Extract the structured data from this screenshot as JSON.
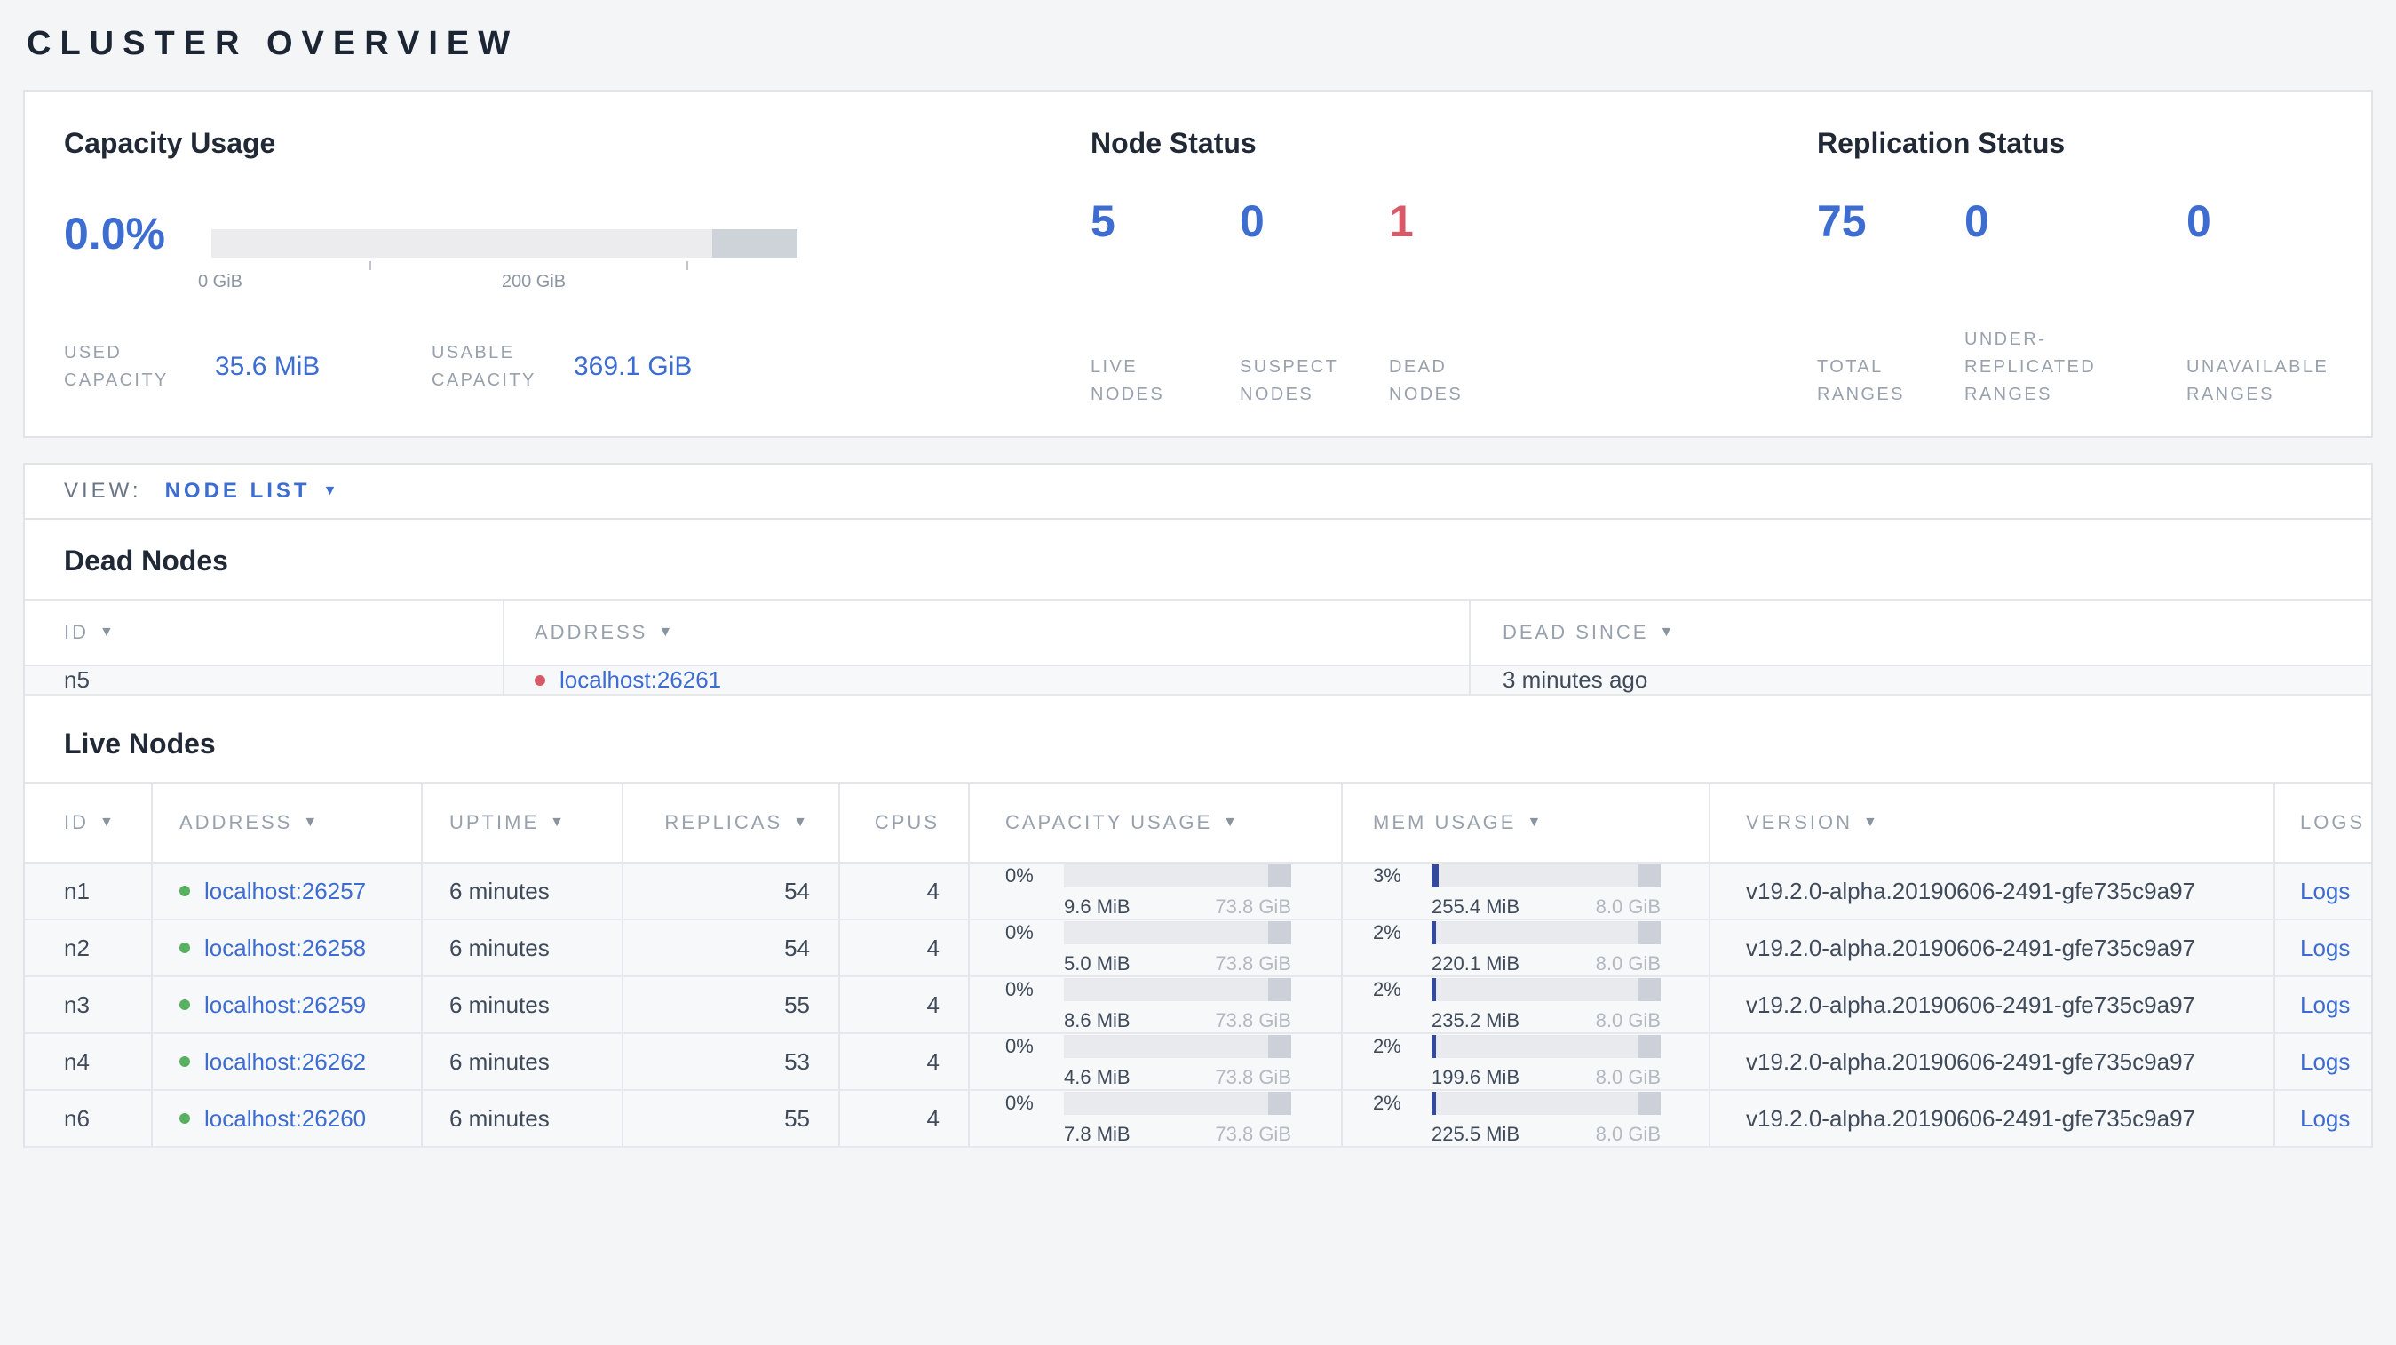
{
  "colors": {
    "accent_blue": "#3d6dd1",
    "status_red": "#d85a68",
    "status_green": "#57b15f"
  },
  "page": {
    "title": "CLUSTER OVERVIEW"
  },
  "summary": {
    "capacity": {
      "heading": "Capacity Usage",
      "percent": "0.0%",
      "fill": "0%",
      "axis_start": "0 GiB",
      "axis_mid": "200 GiB",
      "used": {
        "label_line1": "USED",
        "label_line2": "CAPACITY",
        "value": "35.6 MiB"
      },
      "usable": {
        "label_line1": "USABLE",
        "label_line2": "CAPACITY",
        "value": "369.1 GiB"
      }
    },
    "node_status": {
      "heading": "Node Status",
      "live": {
        "value": "5",
        "label_line1": "LIVE",
        "label_line2": "NODES"
      },
      "suspect": {
        "value": "0",
        "label_line1": "SUSPECT",
        "label_line2": "NODES"
      },
      "dead": {
        "value": "1",
        "label_line1": "DEAD",
        "label_line2": "NODES"
      }
    },
    "replication": {
      "heading": "Replication Status",
      "total": {
        "value": "75",
        "label_line1": "TOTAL",
        "label_line2": "RANGES"
      },
      "under_replicated": {
        "value": "0",
        "label_line1": "UNDER-",
        "label_line2": "REPLICATED",
        "label_line3": "RANGES"
      },
      "unavailable": {
        "value": "0",
        "label_line1": "UNAVAILABLE",
        "label_line2": "RANGES"
      }
    }
  },
  "view_bar": {
    "label": "VIEW:",
    "selected": "NODE LIST"
  },
  "dead_nodes": {
    "heading": "Dead Nodes",
    "columns": {
      "id": "ID",
      "address": "ADDRESS",
      "dead_since": "DEAD SINCE"
    },
    "rows": [
      {
        "id": "n5",
        "address": "localhost:26261",
        "dead_since": "3 minutes ago"
      }
    ]
  },
  "live_nodes": {
    "heading": "Live Nodes",
    "columns": {
      "id": "ID",
      "address": "ADDRESS",
      "uptime": "UPTIME",
      "replicas": "REPLICAS",
      "cpus": "CPUS",
      "capacity": "CAPACITY USAGE",
      "mem": "MEM USAGE",
      "version": "VERSION",
      "logs": "LOGS"
    },
    "rows": [
      {
        "id": "n1",
        "address": "localhost:26257",
        "uptime": "6 minutes",
        "replicas": "54",
        "cpus": "4",
        "capacity": {
          "pct": "0%",
          "fill": "0%",
          "used": "9.6 MiB",
          "total": "73.8 GiB"
        },
        "mem": {
          "pct": "3%",
          "fill": "3%",
          "used": "255.4 MiB",
          "total": "8.0 GiB"
        },
        "version": "v19.2.0-alpha.20190606-2491-gfe735c9a97",
        "logs_label": "Logs"
      },
      {
        "id": "n2",
        "address": "localhost:26258",
        "uptime": "6 minutes",
        "replicas": "54",
        "cpus": "4",
        "capacity": {
          "pct": "0%",
          "fill": "0%",
          "used": "5.0 MiB",
          "total": "73.8 GiB"
        },
        "mem": {
          "pct": "2%",
          "fill": "2%",
          "used": "220.1 MiB",
          "total": "8.0 GiB"
        },
        "version": "v19.2.0-alpha.20190606-2491-gfe735c9a97",
        "logs_label": "Logs"
      },
      {
        "id": "n3",
        "address": "localhost:26259",
        "uptime": "6 minutes",
        "replicas": "55",
        "cpus": "4",
        "capacity": {
          "pct": "0%",
          "fill": "0%",
          "used": "8.6 MiB",
          "total": "73.8 GiB"
        },
        "mem": {
          "pct": "2%",
          "fill": "2%",
          "used": "235.2 MiB",
          "total": "8.0 GiB"
        },
        "version": "v19.2.0-alpha.20190606-2491-gfe735c9a97",
        "logs_label": "Logs"
      },
      {
        "id": "n4",
        "address": "localhost:26262",
        "uptime": "6 minutes",
        "replicas": "53",
        "cpus": "4",
        "capacity": {
          "pct": "0%",
          "fill": "0%",
          "used": "4.6 MiB",
          "total": "73.8 GiB"
        },
        "mem": {
          "pct": "2%",
          "fill": "2%",
          "used": "199.6 MiB",
          "total": "8.0 GiB"
        },
        "version": "v19.2.0-alpha.20190606-2491-gfe735c9a97",
        "logs_label": "Logs"
      },
      {
        "id": "n6",
        "address": "localhost:26260",
        "uptime": "6 minutes",
        "replicas": "55",
        "cpus": "4",
        "capacity": {
          "pct": "0%",
          "fill": "0%",
          "used": "7.8 MiB",
          "total": "73.8 GiB"
        },
        "mem": {
          "pct": "2%",
          "fill": "2%",
          "used": "225.5 MiB",
          "total": "8.0 GiB"
        },
        "version": "v19.2.0-alpha.20190606-2491-gfe735c9a97",
        "logs_label": "Logs"
      }
    ]
  }
}
